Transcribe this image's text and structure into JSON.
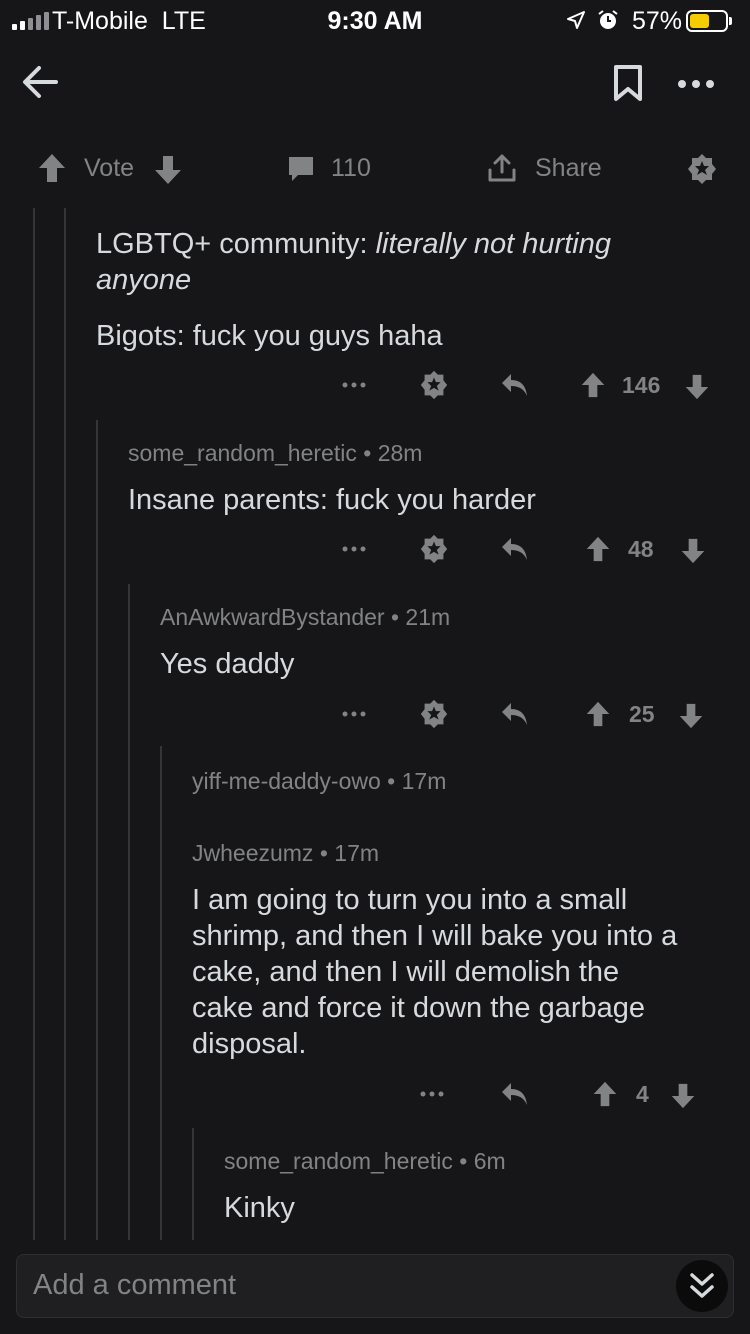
{
  "status": {
    "carrier": "T-Mobile",
    "network": "LTE",
    "time": "9:30 AM",
    "battery_pct": "57%",
    "battery_level": 0.57,
    "battery_color": "#f5cc00",
    "icons": [
      "signal-bars-icon",
      "location-arrow-icon",
      "alarm-icon",
      "battery-icon"
    ]
  },
  "nav": {
    "back_icon": "arrow-left-icon",
    "save_icon": "bookmark-icon",
    "more_icon": "more-dots-icon"
  },
  "post_actions": {
    "vote_label": "Vote",
    "comments_count": "110",
    "share_label": "Share",
    "award_icon": "award-icon"
  },
  "comments": [
    {
      "author": "",
      "age": "",
      "body_line1_plain": "LGBTQ+ community: ",
      "body_line1_italic": "literally not hurting",
      "body_line2_italic": "anyone",
      "body_line3": "Bigots: fuck you guys haha",
      "score": "146"
    },
    {
      "author": "some_random_heretic",
      "age": "28m",
      "body": "Insane parents: fuck you harder",
      "score": "48"
    },
    {
      "author": "AnAwkwardBystander",
      "age": "21m",
      "body": "Yes daddy",
      "score": "25"
    },
    {
      "author": "yiff-me-daddy-owo",
      "age": "17m",
      "body": ""
    },
    {
      "author": "Jwheezumz",
      "age": "17m",
      "body_lines": [
        "I am going to turn you into a small",
        "shrimp, and then I will bake you into a",
        "cake, and then I will demolish the",
        "cake and force it down the garbage",
        "disposal."
      ],
      "score": "4"
    },
    {
      "author": "some_random_heretic",
      "age": "6m",
      "body": "Kinky"
    }
  ],
  "separator": "•",
  "comment_input": {
    "placeholder": "Add a comment",
    "jump_icon": "double-chevron-down-icon"
  }
}
